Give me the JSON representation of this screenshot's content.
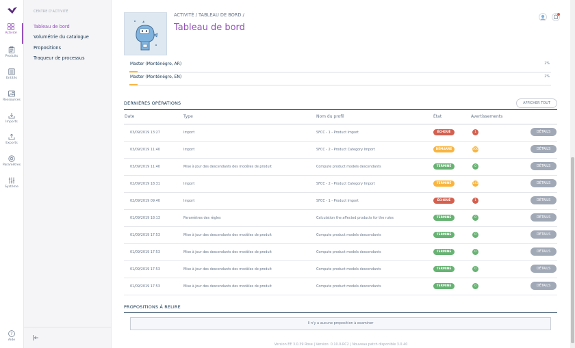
{
  "nav": {
    "activity": "Activité",
    "products": "Produits",
    "entities": "Entités",
    "assets": "Ressources",
    "imports": "Imports",
    "exports": "Exports",
    "settings": "Paramètres",
    "system": "Système",
    "help": "Aide"
  },
  "subnav": {
    "title": "CENTRE D'ACTIVITÉ",
    "items": [
      "Tableau de bord",
      "Volumétrie du catalogue",
      "Propositions",
      "Traqueur de processus"
    ]
  },
  "header": {
    "breadcrumb_activity": "ACTIVITÉ",
    "breadcrumb_sep": " / ",
    "breadcrumb_dashboard": "TABLEAU DE BORD",
    "breadcrumb_trail": " /",
    "title": "Tableau de bord"
  },
  "completeness": [
    {
      "name": "Master (Monténégro, AR)",
      "pct": "2%",
      "value": 0.02
    },
    {
      "name": "Master (Monténégro, EN)",
      "pct": "2%",
      "value": 0.02
    }
  ],
  "operations": {
    "title": "DERNIÈRES OPÉRATIONS",
    "show_all": "AFFICHER TOUT",
    "columns": {
      "date": "Date",
      "type": "Type",
      "profile": "Nom du profil",
      "state": "État",
      "warnings": "Avertissements"
    },
    "rows": [
      {
        "date": "03/09/2019 13:27",
        "type": "Import",
        "profile": "SFCC - 1 - Product Import",
        "state": "ÉCHOUÉ",
        "state_kind": "failed",
        "warnings": "1",
        "warn_kind": "red",
        "details": "DÉTAILS"
      },
      {
        "date": "03/09/2019 11:40",
        "type": "Import",
        "profile": "SFCC - 2 - Product Category Import",
        "state": "DÉMARRÉ",
        "state_kind": "started",
        "warnings": "306",
        "warn_kind": "yellow",
        "details": "DÉTAILS"
      },
      {
        "date": "03/09/2019 11:40",
        "type": "Mise à jour des descendants des modèles de produit",
        "profile": "Compute product models descendants",
        "state": "TERMINÉ",
        "state_kind": "done",
        "warnings": "0",
        "warn_kind": "green",
        "details": "DÉTAILS"
      },
      {
        "date": "02/09/2019 18:31",
        "type": "Import",
        "profile": "SFCC - 2 - Product Category Import",
        "state": "TERMINÉ",
        "state_kind": "started",
        "warnings": "143",
        "warn_kind": "yellow",
        "details": "DÉTAILS"
      },
      {
        "date": "02/09/2019 09:40",
        "type": "Import",
        "profile": "SFCC - 1 - Product Import",
        "state": "ÉCHOUÉ",
        "state_kind": "failed",
        "warnings": "1",
        "warn_kind": "red",
        "details": "DÉTAILS"
      },
      {
        "date": "01/09/2019 18:13",
        "type": "Paramètres des règles",
        "profile": "Calculation the affected products for the rules",
        "state": "TERMINÉ",
        "state_kind": "done",
        "warnings": "0",
        "warn_kind": "green",
        "details": "DÉTAILS"
      },
      {
        "date": "01/09/2019 17:53",
        "type": "Mise à jour des descendants des modèles de produit",
        "profile": "Compute product models descendants",
        "state": "TERMINÉ",
        "state_kind": "done",
        "warnings": "0",
        "warn_kind": "green",
        "details": "DÉTAILS"
      },
      {
        "date": "01/09/2019 17:53",
        "type": "Mise à jour des descendants des modèles de produit",
        "profile": "Compute product models descendants",
        "state": "TERMINÉ",
        "state_kind": "done",
        "warnings": "0",
        "warn_kind": "green",
        "details": "DÉTAILS"
      },
      {
        "date": "01/09/2019 17:53",
        "type": "Mise à jour des descendants des modèles de produit",
        "profile": "Compute product models descendants",
        "state": "TERMINÉ",
        "state_kind": "done",
        "warnings": "0",
        "warn_kind": "green",
        "details": "DÉTAILS"
      },
      {
        "date": "01/09/2019 17:53",
        "type": "Mise à jour des descendants des modèles de produit",
        "profile": "Compute product models descendants",
        "state": "TERMINÉ",
        "state_kind": "done",
        "warnings": "0",
        "warn_kind": "green",
        "details": "DÉTAILS"
      }
    ]
  },
  "proposals": {
    "title": "PROPOSITIONS À RELIRE",
    "empty": "Il n'y a aucune proposition à examiner"
  },
  "footer": "Version EE 3.0.39 Rose | Version: 0.10.0-RC2 | Nouveau patch disponible 3.0.40",
  "colors": {
    "accent": "#9452ba",
    "navy": "#11324d",
    "failed": "#d4604f",
    "started": "#f9b53f",
    "done": "#67b373",
    "grey": "#a1a9b7"
  }
}
